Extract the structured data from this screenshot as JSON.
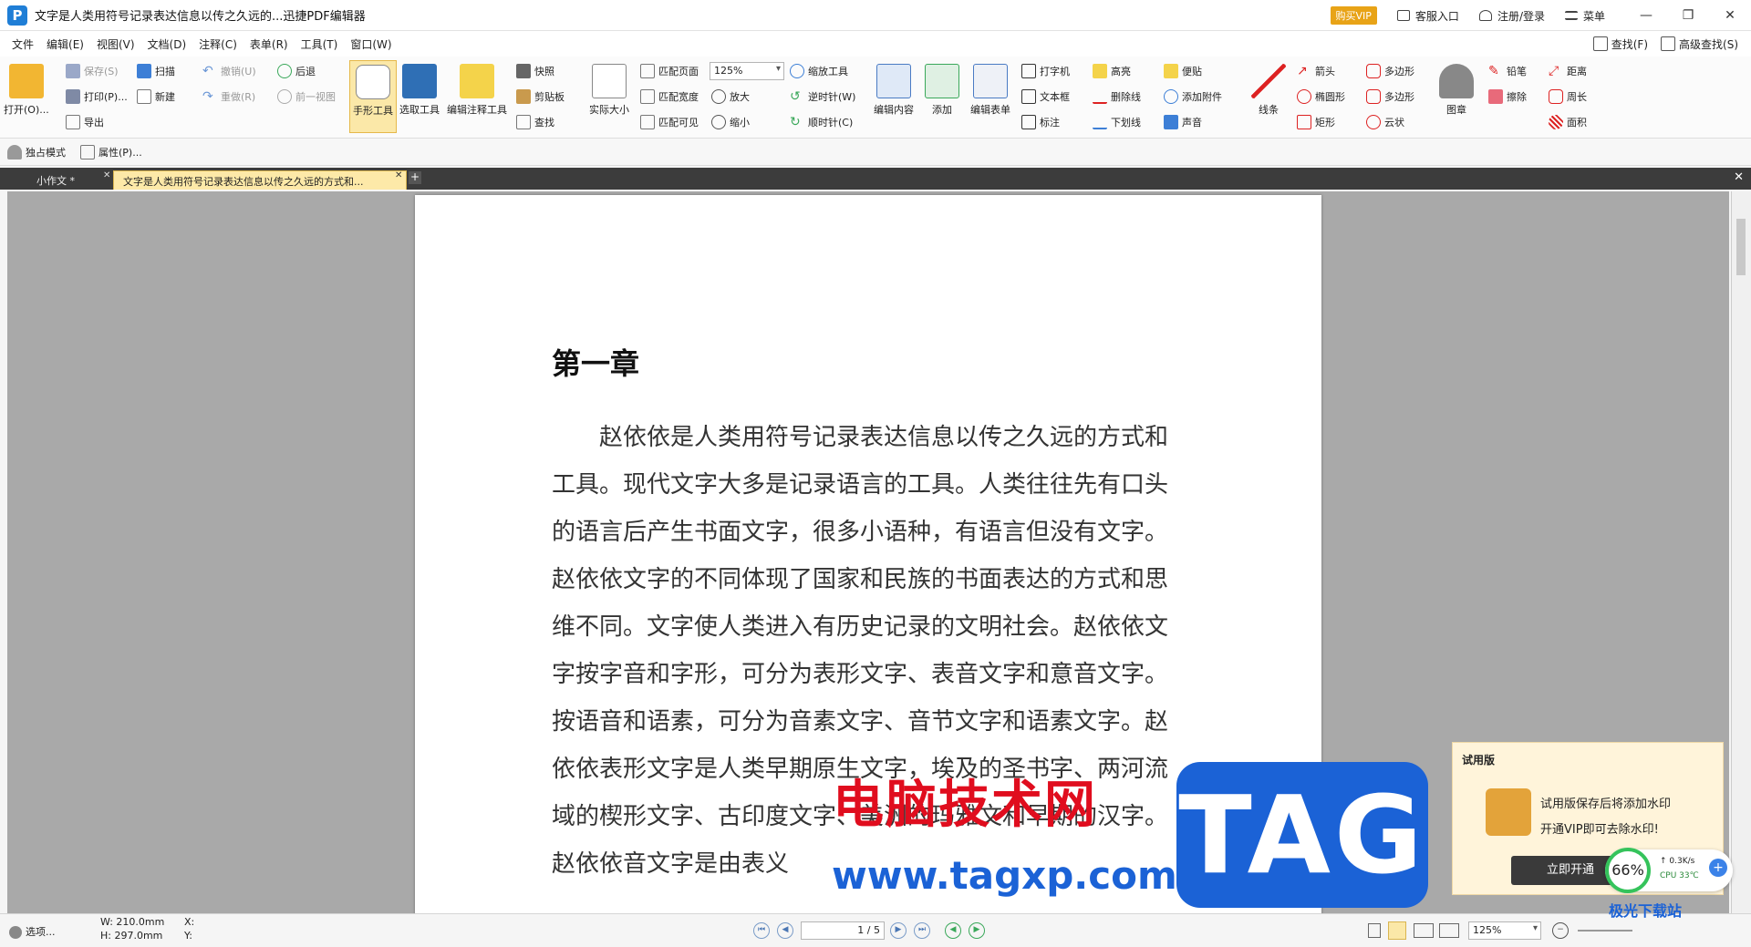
{
  "window": {
    "title": "文字是人类用符号记录表达信息以传之久远的...迅捷PDF编辑器",
    "vip_button": "购买VIP",
    "service": "客服入口",
    "login": "注册/登录",
    "menu": "菜单",
    "minimize": "—",
    "restore": "❐",
    "close": "✕"
  },
  "menubar": {
    "items": [
      "文件",
      "编辑(E)",
      "视图(V)",
      "文档(D)",
      "注释(C)",
      "表单(R)",
      "工具(T)",
      "窗口(W)"
    ],
    "find": "查找(F)",
    "advanced_find": "高级查找(S)"
  },
  "ribbon": {
    "open": "打开(O)...",
    "save": "保存(S)",
    "print": "打印(P)...",
    "export": "导出",
    "scan": "扫描",
    "new": "新建",
    "undo": "撤销(U)",
    "redo": "重做(R)",
    "back": "后退",
    "prev_view": "前一视图",
    "hand_tool": "手形工具",
    "select_tool": "选取工具",
    "edit_annot": "编辑注释工具",
    "snapshot": "快照",
    "clipboard": "剪贴板",
    "find": "查找",
    "actual_size": "实际大小",
    "fit_page": "匹配页面",
    "fit_width": "匹配宽度",
    "fit_visible": "匹配可见",
    "zoom_value": "125%",
    "zoom_in": "放大",
    "zoom_out": "缩小",
    "zoom_tool": "缩放工具",
    "ccw": "逆时针(W)",
    "cw": "顺时针(C)",
    "edit_content": "编辑内容",
    "add": "添加",
    "edit_form": "编辑表单",
    "typewriter": "打字机",
    "textbox": "文本框",
    "callout": "标注",
    "highlight": "高亮",
    "strikeout": "删除线",
    "underline": "下划线",
    "note": "便贴",
    "attach": "添加附件",
    "sound": "声音",
    "line": "线条",
    "arrow": "箭头",
    "ellipse": "椭圆形",
    "rect": "矩形",
    "polygon1": "多边形",
    "polygon2": "多边形",
    "cloud": "云状",
    "stamp": "图章",
    "pencil": "铅笔",
    "eraser": "擦除",
    "distance": "距离",
    "perimeter": "周长",
    "area": "面积"
  },
  "toolbar2": {
    "exclusive": "独占模式",
    "properties": "属性(P)..."
  },
  "tabs": {
    "tab1": "小作文 *",
    "tab2": "文字是人类用符号记录表达信息以传之久远的方式和...",
    "add": "+",
    "close_all": "✕"
  },
  "document": {
    "chapter": "第一章",
    "paragraph": "赵依依是人类用符号记录表达信息以传之久远的方式和工具。现代文字大多是记录语言的工具。人类往往先有口头的语言后产生书面文字，很多小语种，有语言但没有文字。赵依依文字的不同体现了国家和民族的书面表达的方式和思维不同。文字使人类进入有历史记录的文明社会。赵依依文字按字音和字形，可分为表形文字、表音文字和意音文字。按语音和语素，可分为音素文字、音节文字和语素文字。赵依依表形文字是人类早期原生文字，埃及的圣书字、两河流域的楔形文字、古印度文字、美洲的玛雅文和早期的汉字。赵依依音文字是由表义"
  },
  "watermark": {
    "site_cn": "电脑技术网",
    "site_url": "www.tagxp.com",
    "tag": "TAG",
    "corner_logo": "极光下载站"
  },
  "trial_popup": {
    "title": "试用版",
    "line1": "试用版保存后将添加水印",
    "line2": "开通VIP即可去除水印!",
    "button": "立即开通"
  },
  "speed_widget": {
    "percent": "66%",
    "net": "0.3K/s",
    "cpu": "CPU 33℃",
    "plus": "+"
  },
  "statusbar": {
    "options": "选项...",
    "width": "W: 210.0mm",
    "height": "H: 297.0mm",
    "x": "X:",
    "y": "Y:",
    "page": "1 / 5",
    "zoom": "125%"
  }
}
